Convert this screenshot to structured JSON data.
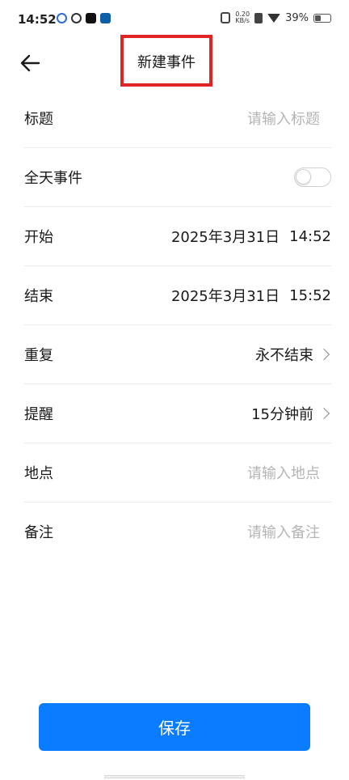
{
  "status_bar": {
    "time": "14:52",
    "net_speed_value": "0.20",
    "net_speed_unit": "KB/s",
    "battery": "39%",
    "battery_level": 0.39,
    "app_icons": [
      "baidu-icon",
      "loop-icon",
      "tiktok-icon",
      "cc-icon"
    ]
  },
  "header": {
    "title": "新建事件",
    "back_icon": "arrow-left-icon"
  },
  "form": {
    "title": {
      "label": "标题",
      "placeholder": "请输入标题"
    },
    "all_day": {
      "label": "全天事件",
      "enabled": false
    },
    "start": {
      "label": "开始",
      "date": "2025年3月31日",
      "time": "14:52"
    },
    "end": {
      "label": "结束",
      "date": "2025年3月31日",
      "time": "15:52"
    },
    "repeat": {
      "label": "重复",
      "value": "永不结束"
    },
    "reminder": {
      "label": "提醒",
      "value": "15分钟前"
    },
    "location": {
      "label": "地点",
      "placeholder": "请输入地点"
    },
    "note": {
      "label": "备注",
      "placeholder": "请输入备注"
    }
  },
  "save_button": {
    "label": "保存"
  },
  "colors": {
    "primary": "#0a7cff",
    "highlight_border": "#e02424",
    "placeholder": "#b4b4b4"
  }
}
